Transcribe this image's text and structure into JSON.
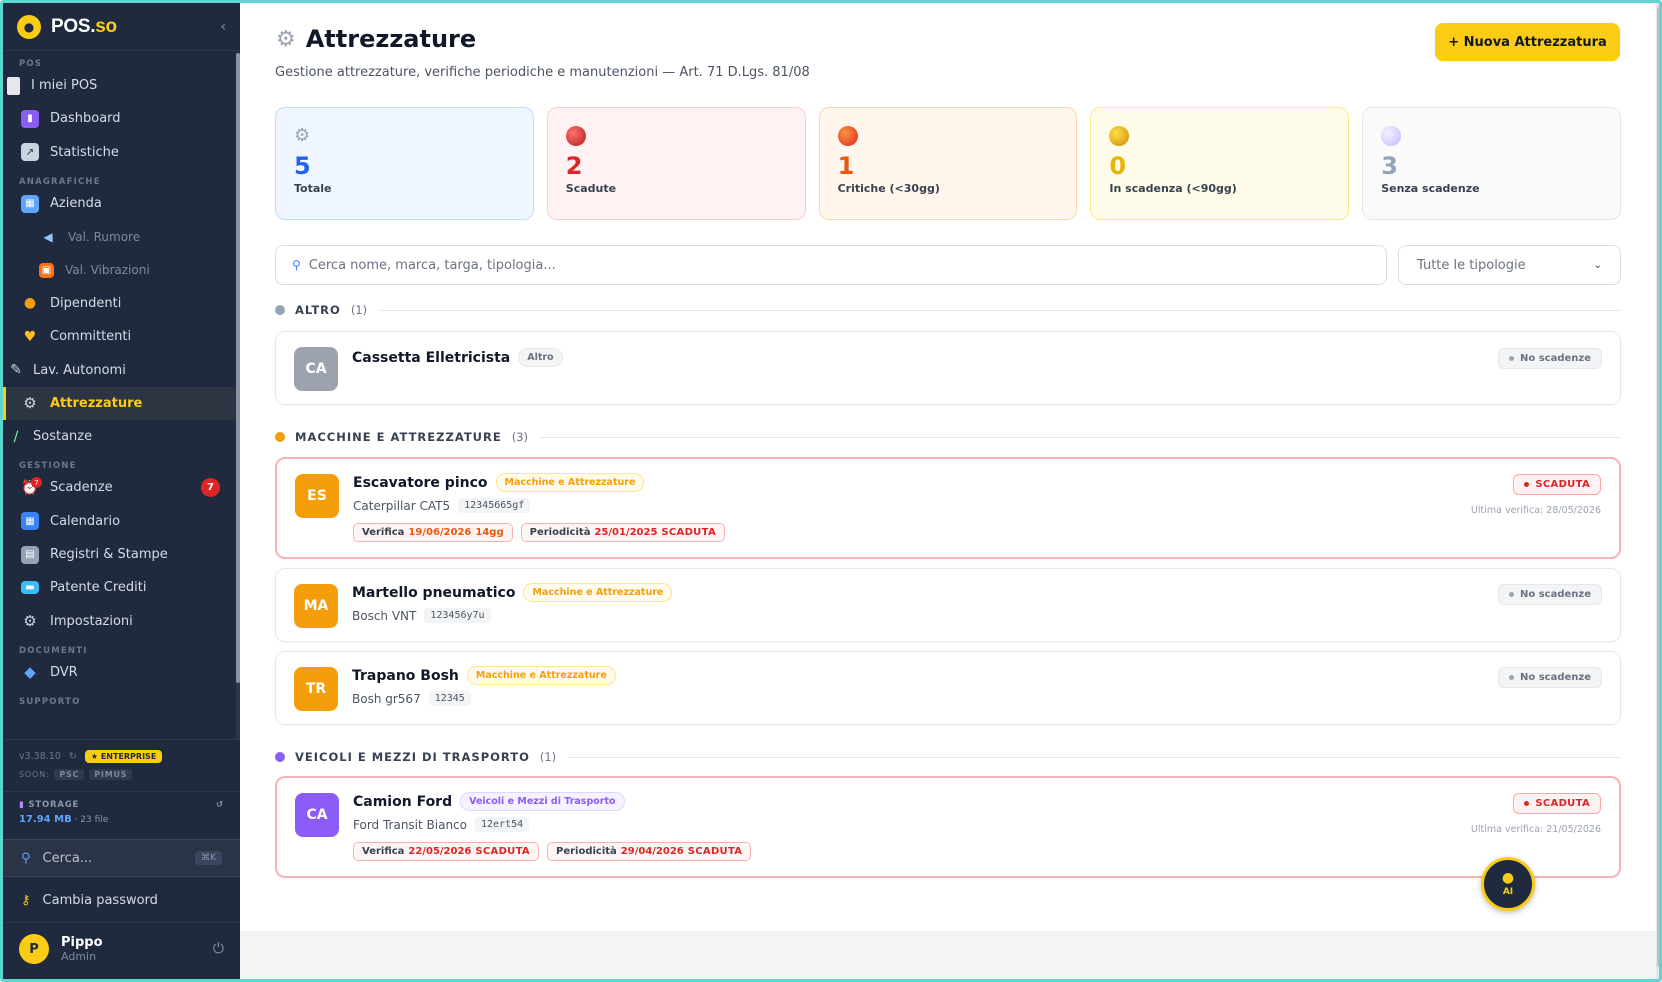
{
  "sidebar": {
    "brand": "POS.",
    "brand_accent": "so",
    "collapse_icon": "‹",
    "sections": {
      "pos": "POS",
      "anagrafiche": "ANAGRAFICHE",
      "gestione": "GESTIONE",
      "documenti": "DOCUMENTI",
      "supporto": "SUPPORTO"
    },
    "items": {
      "miei_pos": "I miei POS",
      "dashboard": "Dashboard",
      "statistiche": "Statistiche",
      "azienda": "Azienda",
      "val_rumore": "Val. Rumore",
      "val_vibrazioni": "Val. Vibrazioni",
      "dipendenti": "Dipendenti",
      "committenti": "Committenti",
      "lav_autonomi": "Lav. Autonomi",
      "attrezzature": "Attrezzature",
      "sostanze": "Sostanze",
      "scadenze": "Scadenze",
      "scadenze_badge": "7",
      "scadenze_mini_badge": "7",
      "calendario": "Calendario",
      "registri": "Registri & Stampe",
      "patente": "Patente Crediti",
      "impostazioni": "Impostazioni",
      "dvr": "DVR"
    },
    "version": "v3.38.10",
    "enterprise": "★ ENTERPRISE",
    "soon_label": "SOON:",
    "soon_chips": [
      "PSC",
      "PIMUS"
    ],
    "storage_label": "STORAGE",
    "storage_size": "17.94 MB",
    "storage_files": " · 23 file",
    "search_label": "Cerca...",
    "search_kbd": "⌘K",
    "change_password": "Cambia password",
    "user_initial": "P",
    "user_name": "Pippo",
    "user_role": "Admin"
  },
  "header": {
    "title": "Attrezzature",
    "subtitle": "Gestione attrezzature, verifiche periodiche e manutenzioni — Art. 71 D.Lgs. 81/08",
    "new_button": "+ Nuova Attrezzatura"
  },
  "stats": [
    {
      "value": "5",
      "label": "Totale"
    },
    {
      "value": "2",
      "label": "Scadute"
    },
    {
      "value": "1",
      "label": "Critiche (<30gg)"
    },
    {
      "value": "0",
      "label": "In scadenza (<90gg)"
    },
    {
      "value": "3",
      "label": "Senza scadenze"
    }
  ],
  "filters": {
    "search_placeholder": "Cerca nome, marca, targa, tipologia...",
    "type_select": "Tutte le tipologie"
  },
  "groups": [
    {
      "title": "ALTRO",
      "count": "(1)"
    },
    {
      "title": "MACCHINE E ATTREZZATURE",
      "count": "(3)"
    },
    {
      "title": "VEICOLI E MEZZI DI TRASPORTO",
      "count": "(1)"
    }
  ],
  "items": {
    "cassetta": {
      "initials": "CA",
      "name": "Cassetta Elletricista",
      "tag": "Altro",
      "status": "No scadenze"
    },
    "escavatore": {
      "initials": "ES",
      "name": "Escavatore pinco",
      "tag": "Macchine e Attrezzature",
      "model": "Caterpillar CAT5",
      "code": "12345665gf",
      "chip1_label": "Verifica",
      "chip1_date": "19/06/2026",
      "chip1_extra": "14gg",
      "chip2_label": "Periodicità",
      "chip2_date": "25/01/2025",
      "chip2_extra": "SCADUTA",
      "status": "SCADUTA",
      "last_check": "Ultima verifica: 28/05/2026"
    },
    "martello": {
      "initials": "MA",
      "name": "Martello pneumatico",
      "tag": "Macchine e Attrezzature",
      "model": "Bosch VNT",
      "code": "123456y7u",
      "status": "No scadenze"
    },
    "trapano": {
      "initials": "TR",
      "name": "Trapano Bosh",
      "tag": "Macchine e Attrezzature",
      "model": "Bosh gr567",
      "code": "12345",
      "status": "No scadenze"
    },
    "camion": {
      "initials": "CA",
      "name": "Camion Ford",
      "tag": "Veicoli e Mezzi di Trasporto",
      "model": "Ford Transit Bianco",
      "code": "12ert54",
      "chip1_label": "Verifica",
      "chip1_date": "22/05/2026",
      "chip1_extra": "SCADUTA",
      "chip2_label": "Periodicità",
      "chip2_date": "29/04/2026",
      "chip2_extra": "SCADUTA",
      "status": "SCADUTA",
      "last_check": "Ultima verifica: 21/05/2026"
    }
  },
  "ai_button": "AI",
  "colors": {
    "accent": "#facc15",
    "sidebar_bg": "#1f2a3e",
    "danger": "#dc2626",
    "orange": "#f59e0b",
    "violet": "#8b5cf6"
  }
}
